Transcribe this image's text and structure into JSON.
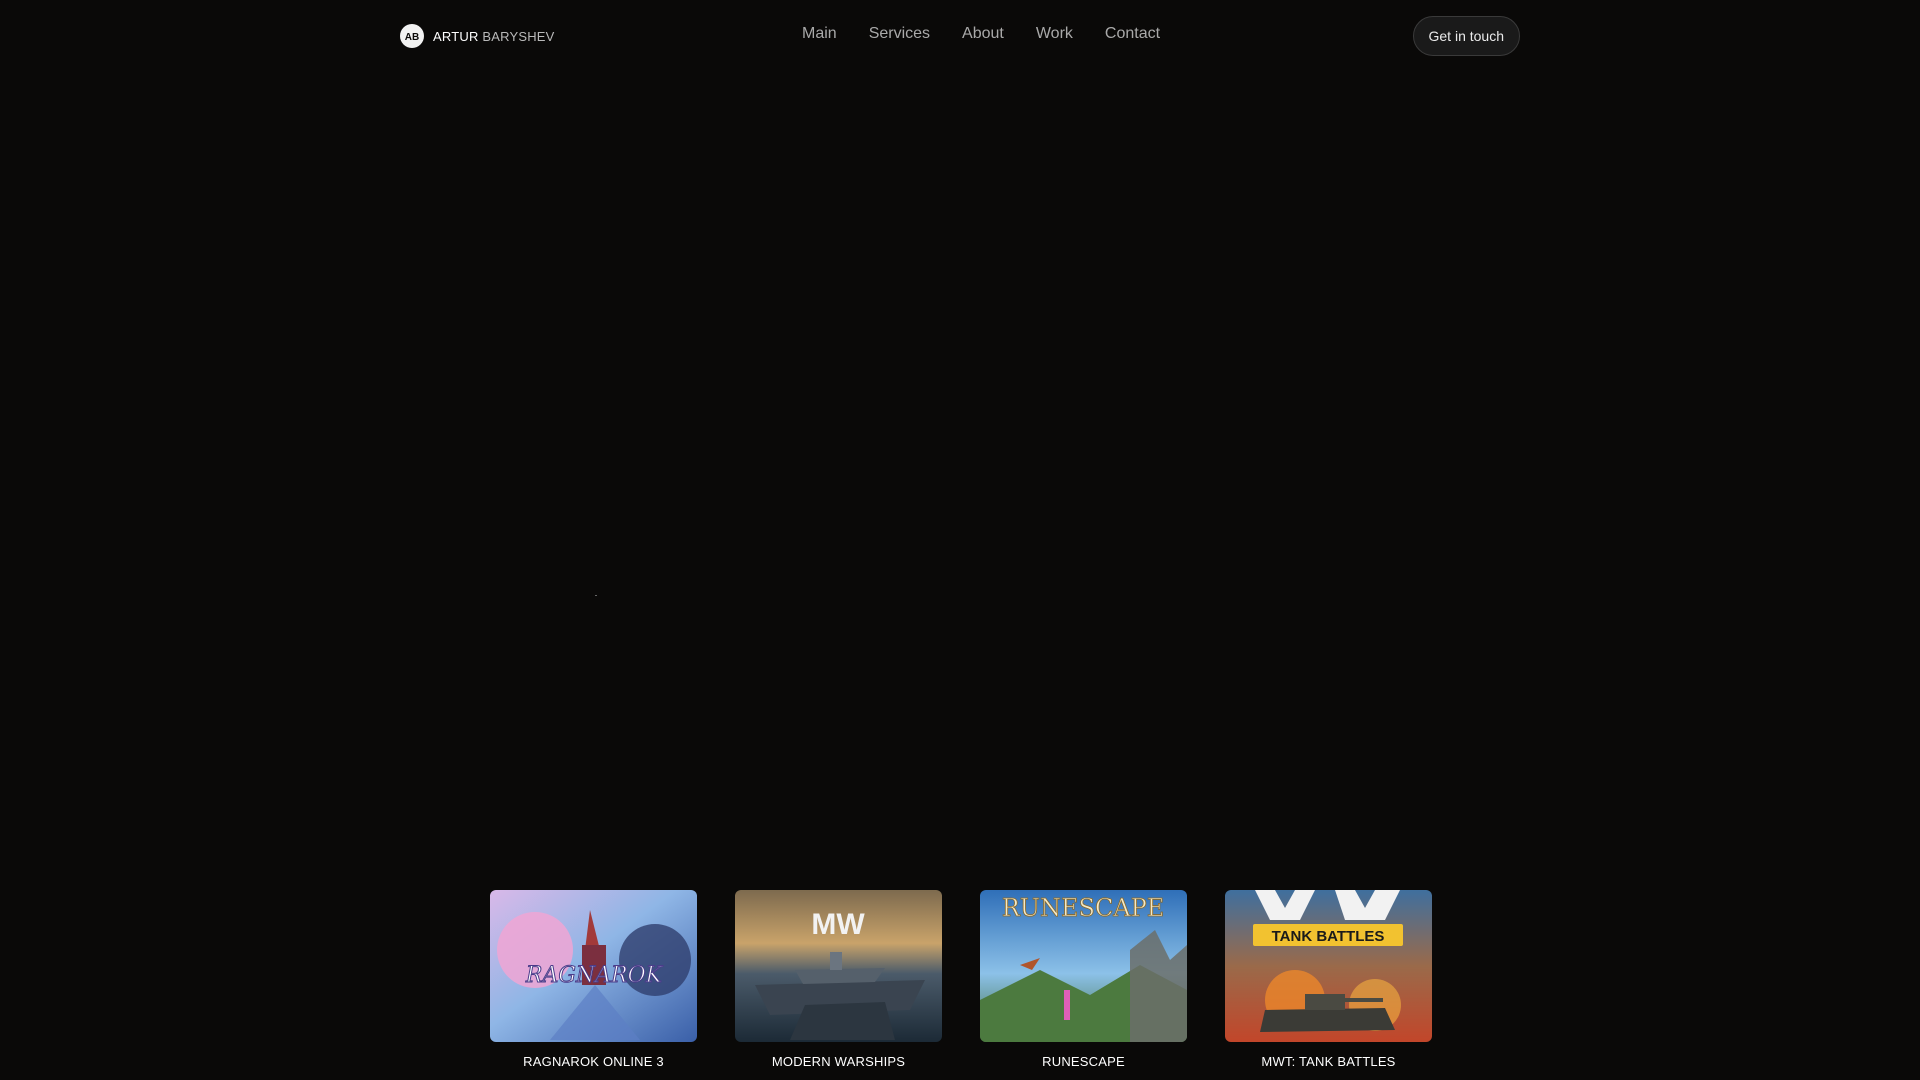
{
  "header": {
    "logo": {
      "initials": "AB",
      "first": "ARTUR ",
      "last": "BARYSHEV"
    },
    "nav": [
      {
        "label": "Main"
      },
      {
        "label": "Services"
      },
      {
        "label": "About"
      },
      {
        "label": "Work"
      },
      {
        "label": "Contact"
      }
    ],
    "cta_label": "Get in touch"
  },
  "work": {
    "items": [
      {
        "title": "RAGNAROK ONLINE 3",
        "thumb_art": "RAGNAROK",
        "thumb_sub": ""
      },
      {
        "title": "MODERN WARSHIPS",
        "thumb_art": "MW",
        "thumb_sub": ""
      },
      {
        "title": "RUNESCAPE",
        "thumb_art": "RUNESCAPE",
        "thumb_sub": ""
      },
      {
        "title": "MWT: TANK BATTLES",
        "thumb_art": "TANK BATTLES",
        "thumb_sub": ""
      }
    ]
  },
  "colors": {
    "background": "#0a0908",
    "nav_text": "#a9a9a9",
    "accent_yellow": "#f2c230"
  }
}
